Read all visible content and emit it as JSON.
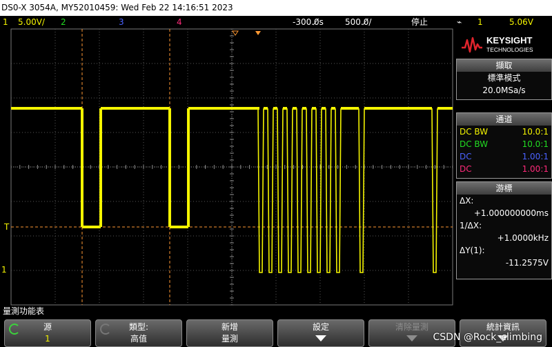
{
  "title": "DS0-X 3054A, MY52010459: Wed Feb 22 14:16:51 2023",
  "status": {
    "ch1_label": "1",
    "ch1_scale": "5.00V/",
    "ch2_label": "2",
    "ch3_label": "3",
    "ch4_label": "4",
    "time_offset": "-300.0̸s",
    "time_scale": "500.0̸/",
    "run_state": "停止",
    "trigger_source": "1",
    "trigger_level": "5.06V"
  },
  "colors": {
    "ch1": "#f5f500",
    "ch2": "#22dd22",
    "ch3": "#4a62ff",
    "ch4": "#ff2a7a",
    "cursor": "#ff9933",
    "grid": "#5a5a5a"
  },
  "logo": {
    "brand": "KEYSIGHT",
    "sub": "TECHNOLOGIES"
  },
  "acquisition": {
    "header": "擷取",
    "mode": "標準模式",
    "rate": "20.0MSa/s"
  },
  "channels": {
    "header": "通道",
    "rows": [
      {
        "coupling": "DC BW",
        "probe": "10.0:1",
        "color": "#f5f500"
      },
      {
        "coupling": "DC BW",
        "probe": "10.0:1",
        "color": "#22dd22"
      },
      {
        "coupling": "DC",
        "probe": "1.00:1",
        "color": "#4a62ff"
      },
      {
        "coupling": "DC",
        "probe": "1.00:1",
        "color": "#ff2a7a"
      }
    ]
  },
  "cursors": {
    "header": "游標",
    "dx_label": "ΔX:",
    "dx_value": "+1.000000000ms",
    "inv_dx_label": "1/ΔX:",
    "inv_dx_value": "+1.0000kHz",
    "dy_label": "ΔY(1):",
    "dy_value": "-11.2575V"
  },
  "measure_menu_label": "量測功能表",
  "softkeys": [
    {
      "line1": "源",
      "line2": "1",
      "icon": "refresh-icon"
    },
    {
      "line1": "類型:",
      "line2": "高值",
      "icon": "refresh-icon"
    },
    {
      "line1": "新增",
      "line2": "量測"
    },
    {
      "line1": "設定",
      "icon": "down-arrow-icon"
    },
    {
      "line1": "清除量測",
      "icon": "down-arrow-icon"
    },
    {
      "line1": "統計資訊",
      "icon": "down-arrow-icon"
    }
  ],
  "watermark": "CSDN @Rock_climbing",
  "trace": {
    "high_level_div": 3,
    "low_level_div": -1.7,
    "edges_ms": [
      0.78,
      0.95,
      1.78,
      1.95
    ]
  },
  "grid_markers": {
    "trigger_marker": "T",
    "ground_marker": "1"
  }
}
